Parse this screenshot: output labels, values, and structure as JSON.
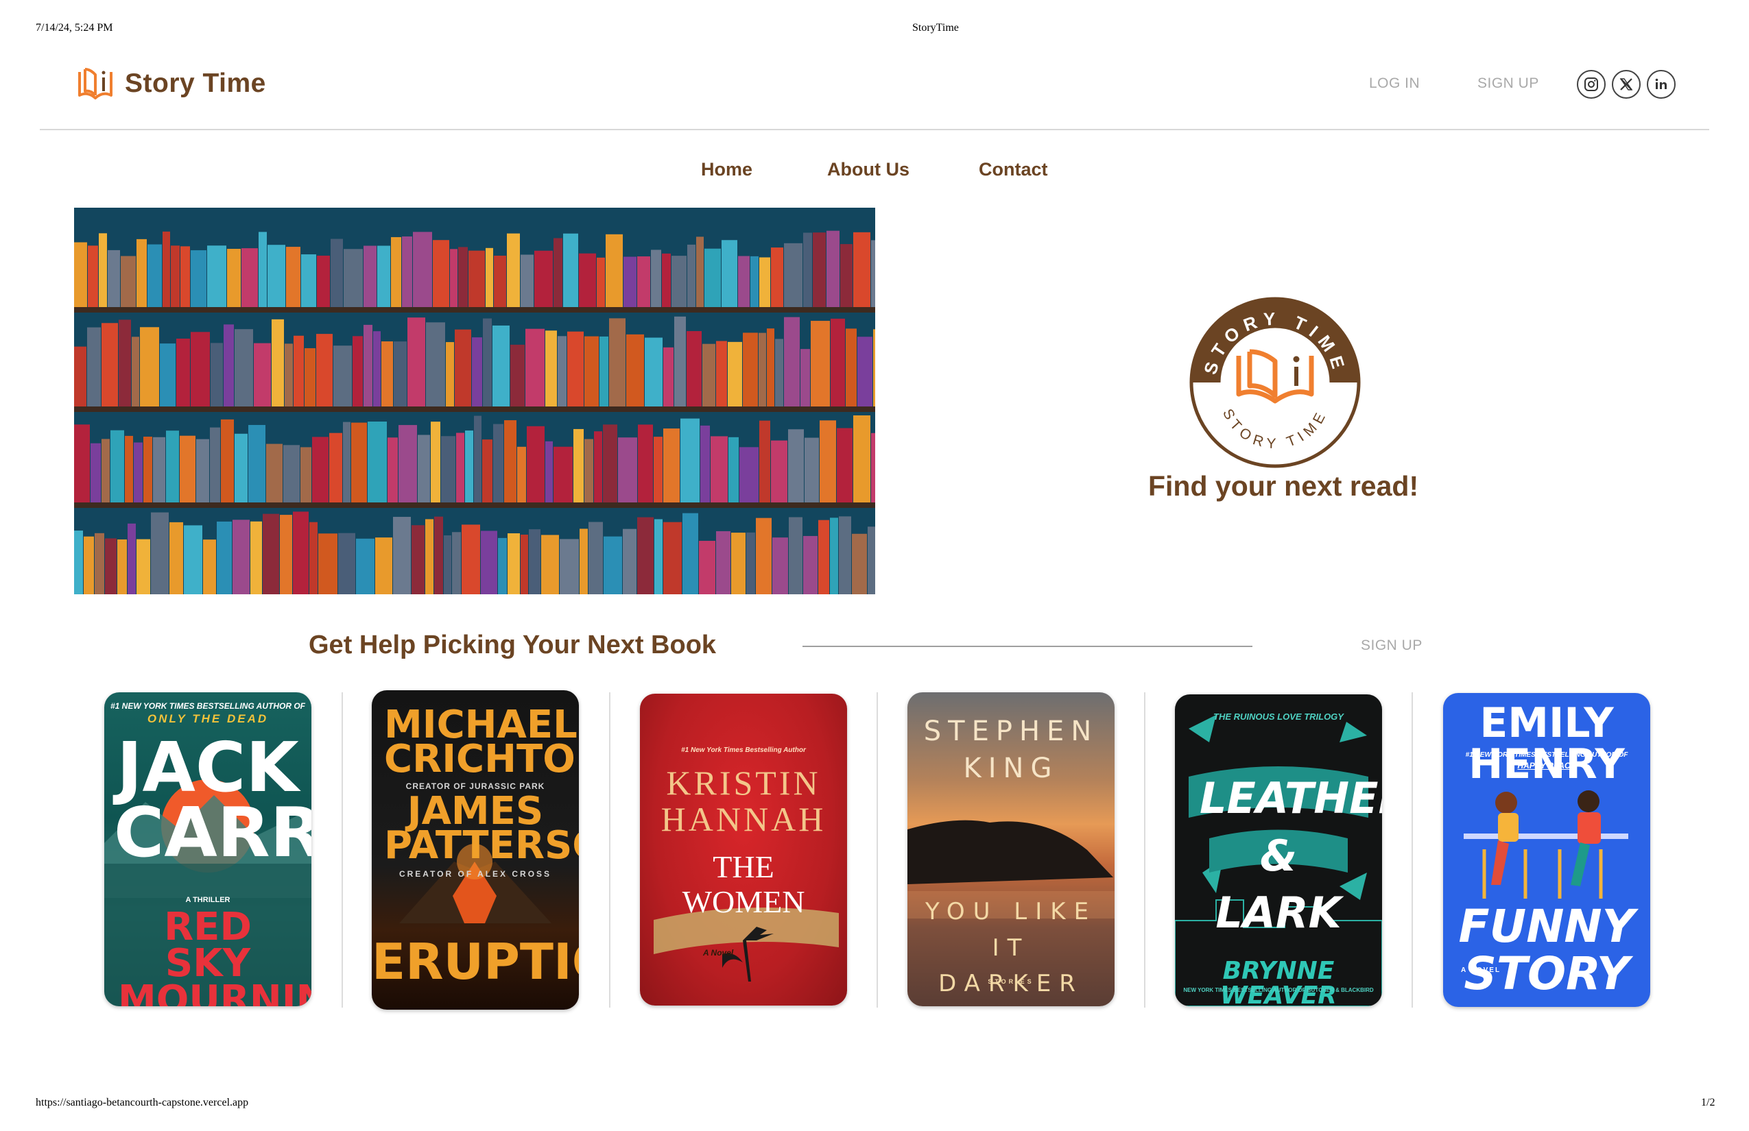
{
  "print_header": {
    "date": "7/14/24, 5:24 PM",
    "title": "StoryTime"
  },
  "print_footer": {
    "url": "https://santiago-betancourth-capstone.vercel.app",
    "page": "1/2"
  },
  "brand": {
    "name": "Story Time",
    "icon": "open-book-icon",
    "accent": "#f07f2f",
    "brown": "#6b4423"
  },
  "header": {
    "login": "LOG IN",
    "signup": "SIGN UP",
    "social": [
      "instagram-icon",
      "x-icon",
      "linkedin-icon"
    ]
  },
  "nav": {
    "items": [
      "Home",
      "About Us",
      "Contact"
    ]
  },
  "hero": {
    "badge_top": "STORY TIME",
    "badge_bottom": "STORY TIME",
    "tagline": "Find your next read!"
  },
  "section": {
    "title": "Get Help Picking Your Next Book",
    "signup": "SIGN UP"
  },
  "books": [
    {
      "cover_top": "#1 NEW YORK TIMES BESTSELLING AUTHOR OF",
      "cover_sub": "ONLY THE DEAD",
      "author": "JACK CARR",
      "genre": "A THRILLER",
      "title": "RED SKY MOURNING"
    },
    {
      "author_1": "MICHAEL CRICHTON",
      "credit_1": "CREATOR OF JURASSIC PARK",
      "author_2": "JAMES PATTERSON",
      "credit_2": "CREATOR OF ALEX CROSS",
      "title": "ERUPTION"
    },
    {
      "cover_top": "#1 New York Times Bestselling Author",
      "author": "KRISTIN HANNAH",
      "title": "THE WOMEN",
      "genre": "A Novel"
    },
    {
      "author": "STEPHEN KING",
      "title": "YOU LIKE IT DARKER",
      "genre": "STORIES"
    },
    {
      "cover_top": "THE RUINOUS LOVE TRILOGY",
      "title": "LEATHER & LARK",
      "author": "BRYNNE WEAVER",
      "cover_bottom": "NEW YORK TIMES BESTSELLING AUTHOR OF BUTCHER & BLACKBIRD"
    },
    {
      "author": "EMILY HENRY",
      "cover_top": "#1 NEW YORK TIMES BESTSELLING AUTHOR OF",
      "cover_sub": "HAPPY PLACE",
      "genre": "A NOVEL",
      "title": "FUNNY STORY"
    }
  ]
}
